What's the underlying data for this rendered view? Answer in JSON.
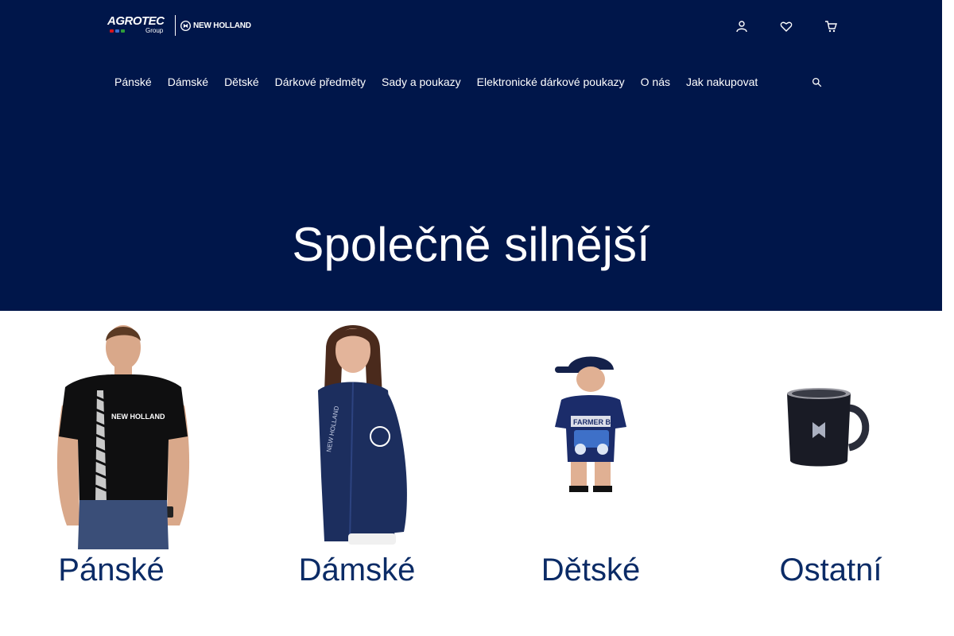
{
  "brand": {
    "agrotec": "AGROTEC",
    "agrotec_sub": "Group",
    "partner": "NEW HOLLAND",
    "flag_colors": [
      "#d7141a",
      "#11457e",
      "#cd2a3e"
    ]
  },
  "header": {
    "icons": [
      "user-icon",
      "heart-icon",
      "cart-icon"
    ],
    "search_icon": "search-icon"
  },
  "nav": {
    "items": [
      "Pánské",
      "Dámské",
      "Dětské",
      "Dárkové předměty",
      "Sady a poukazy",
      "Elektronické dárkové poukazy",
      "O nás",
      "Jak nakupovat"
    ]
  },
  "hero": {
    "title": "Společně silnější",
    "background": "#00164a"
  },
  "categories": [
    {
      "label": "Pánské",
      "image": "man-in-black-t-shirt"
    },
    {
      "label": "Dámské",
      "image": "woman-in-navy-jacket"
    },
    {
      "label": "Dětské",
      "image": "child-in-cap-and-t-shirt"
    },
    {
      "label": "Ostatní",
      "image": "navy-mug"
    }
  ],
  "colors": {
    "accent": "#00164a",
    "category_label": "#0b2b66"
  }
}
